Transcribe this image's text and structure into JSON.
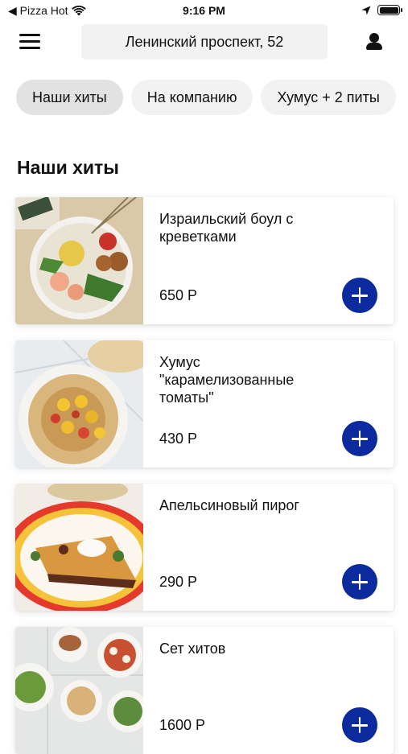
{
  "status": {
    "carrier": "◀ Pizza Hot",
    "time": "9:16 PM"
  },
  "header": {
    "address": "Ленинский проспект, 52"
  },
  "categories": [
    {
      "label": "Наши хиты",
      "active": true
    },
    {
      "label": "На компанию",
      "active": false
    },
    {
      "label": "Хумус + 2 питы",
      "active": false
    }
  ],
  "section": {
    "title": "Наши хиты"
  },
  "products": [
    {
      "name": "Израильский боул с креветками",
      "price": "650 Р"
    },
    {
      "name": "Хумус \"карамелизованные томаты\"",
      "price": "430 Р"
    },
    {
      "name": "Апельсиновый пирог",
      "price": "290 Р"
    },
    {
      "name": "Сет хитов",
      "price": "1600 Р"
    }
  ],
  "colors": {
    "accent": "#0b2a9e",
    "chip_bg": "#f2f2f2"
  }
}
